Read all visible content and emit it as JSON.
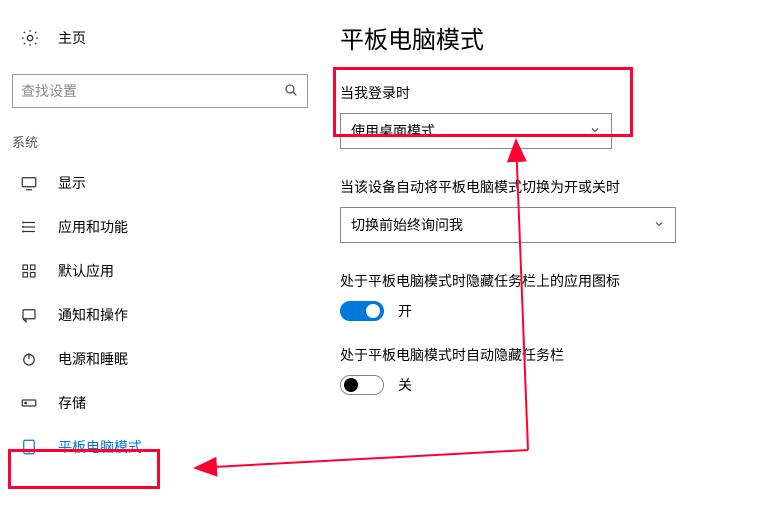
{
  "sidebar": {
    "home_label": "主页",
    "search_placeholder": "查找设置",
    "section_label": "系统",
    "items": [
      {
        "label": "显示",
        "icon": "display-icon"
      },
      {
        "label": "应用和功能",
        "icon": "apps-icon"
      },
      {
        "label": "默认应用",
        "icon": "default-apps-icon"
      },
      {
        "label": "通知和操作",
        "icon": "notifications-icon"
      },
      {
        "label": "电源和睡眠",
        "icon": "power-icon"
      },
      {
        "label": "存储",
        "icon": "storage-icon"
      },
      {
        "label": "平板电脑模式",
        "icon": "tablet-icon"
      }
    ],
    "selected_index": 6
  },
  "main": {
    "title": "平板电脑模式",
    "signin_label": "当我登录时",
    "signin_value": "使用桌面模式",
    "autoswitch_label": "当该设备自动将平板电脑模式切换为开或关时",
    "autoswitch_value": "切换前始终询问我",
    "hide_icons_label": "处于平板电脑模式时隐藏任务栏上的应用图标",
    "hide_icons_state": "开",
    "hide_taskbar_label": "处于平板电脑模式时自动隐藏任务栏",
    "hide_taskbar_state": "关"
  },
  "annotations": {
    "color": "#ff0033",
    "highlight_nav_item": 6,
    "highlight_section1": true
  }
}
